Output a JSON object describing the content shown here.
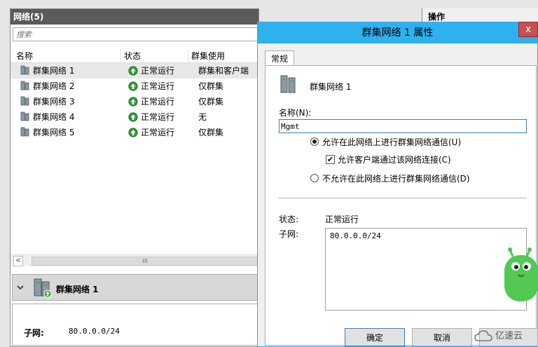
{
  "networks_pane": {
    "title": "网络(5)",
    "search_placeholder": "搜索",
    "columns": [
      "名称",
      "状态",
      "群集使用"
    ],
    "rows": [
      {
        "name": "群集网络 1",
        "status": "正常运行",
        "usage": "群集和客户端"
      },
      {
        "name": "群集网络 2",
        "status": "正常运行",
        "usage": "仅群集"
      },
      {
        "name": "群集网络 3",
        "status": "正常运行",
        "usage": "仅群集"
      },
      {
        "name": "群集网络 4",
        "status": "正常运行",
        "usage": "无"
      },
      {
        "name": "群集网络 5",
        "status": "正常运行",
        "usage": "仅群集"
      }
    ],
    "scroll_thumb_glyph": "III",
    "scroll_left_glyph": "<",
    "detail": {
      "title": "群集网络 1",
      "subnet_label": "子网:",
      "subnet_value": "80.0.0.0/24"
    }
  },
  "actions_pane": {
    "title": "操作"
  },
  "dialog": {
    "title": "群集网络 1 属性",
    "close_glyph": "x",
    "tab_label": "常规",
    "network_name": "群集网络 1",
    "name_label": "名称(N):",
    "name_value": "Mgmt",
    "option_allow": "允许在此网络上进行群集网络通信(U)",
    "option_allow_clients": "允许客户端通过该网络连接(C)",
    "option_disallow": "不允许在此网络上进行群集网络通信(D)",
    "status_label": "状态:",
    "status_value": "正常运行",
    "subnet_label": "子网:",
    "subnet_value": "80.0.0.0/24",
    "ok_label": "确定",
    "cancel_label": "取消"
  },
  "watermark": {
    "text": "亿速云"
  },
  "colors": {
    "dialog_title_bg": "#2eb1ef",
    "close_button": "#c75050",
    "pane_header": "#5a5a5a",
    "status_ok_green": "#2e9b2e"
  },
  "icons": [
    "server-icon",
    "status-ok-icon",
    "chevron-down-icon",
    "mascot-icon",
    "cloud-logo-icon"
  ]
}
